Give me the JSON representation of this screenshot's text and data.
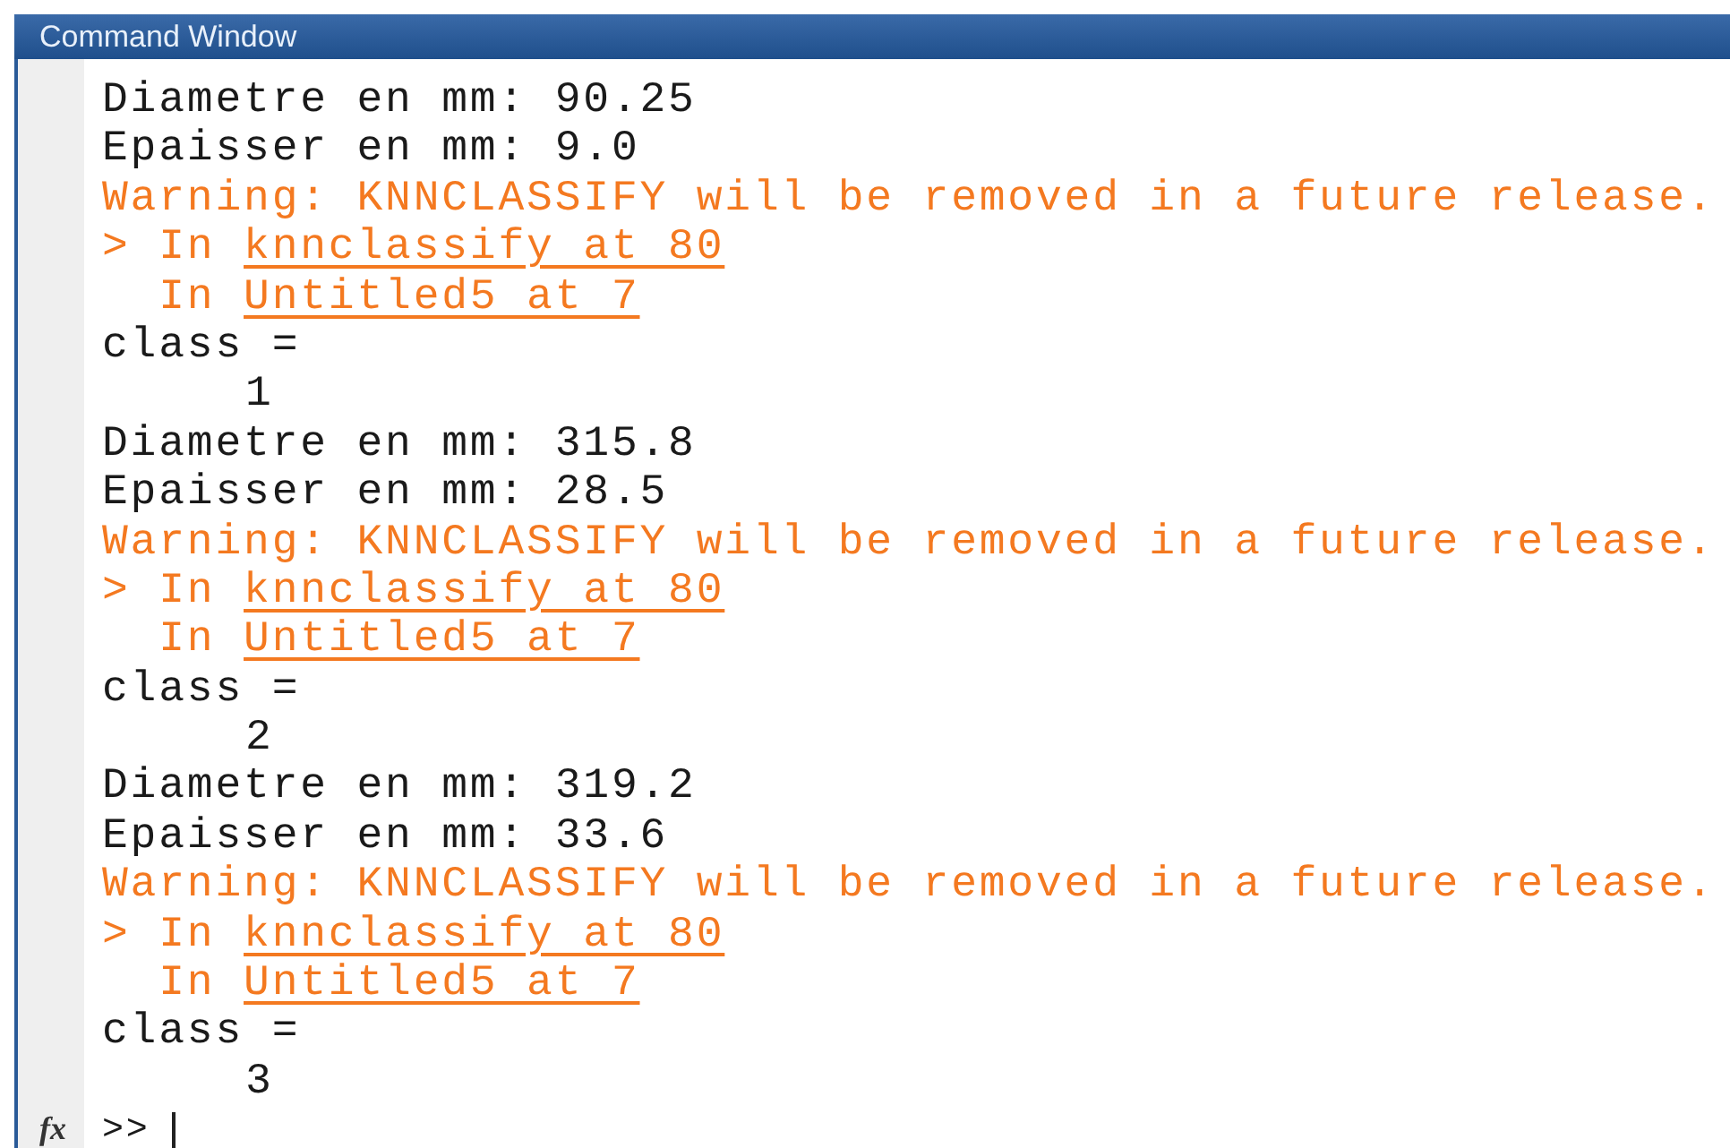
{
  "window": {
    "title": "Command Window"
  },
  "lines": [
    {
      "kind": "output",
      "text": "Diametre en mm: 90.25"
    },
    {
      "kind": "output",
      "text": "Epaisser en mm: 9.0"
    },
    {
      "kind": "warning",
      "text": "Warning: KNNCLASSIFY will be removed in a future release."
    },
    {
      "kind": "trace",
      "prefix": "> In ",
      "link": "knnclassify at 80"
    },
    {
      "kind": "trace",
      "prefix": "  In ",
      "link": "Untitled5 at 7"
    },
    {
      "kind": "output",
      "text": "class ="
    },
    {
      "kind": "value",
      "text": "1"
    },
    {
      "kind": "output",
      "text": "Diametre en mm: 315.8"
    },
    {
      "kind": "output",
      "text": "Epaisser en mm: 28.5"
    },
    {
      "kind": "warning",
      "text": "Warning: KNNCLASSIFY will be removed in a future release."
    },
    {
      "kind": "trace",
      "prefix": "> In ",
      "link": "knnclassify at 80"
    },
    {
      "kind": "trace",
      "prefix": "  In ",
      "link": "Untitled5 at 7"
    },
    {
      "kind": "output",
      "text": "class ="
    },
    {
      "kind": "value",
      "text": "2"
    },
    {
      "kind": "output",
      "text": "Diametre en mm: 319.2"
    },
    {
      "kind": "output",
      "text": "Epaisser en mm: 33.6"
    },
    {
      "kind": "warning",
      "text": "Warning: KNNCLASSIFY will be removed in a future release."
    },
    {
      "kind": "trace",
      "prefix": "> In ",
      "link": "knnclassify at 80"
    },
    {
      "kind": "trace",
      "prefix": "  In ",
      "link": "Untitled5 at 7"
    },
    {
      "kind": "output",
      "text": "class ="
    },
    {
      "kind": "value",
      "text": "3"
    }
  ],
  "prompt": {
    "icon_label": "fx",
    "text": ">>"
  }
}
